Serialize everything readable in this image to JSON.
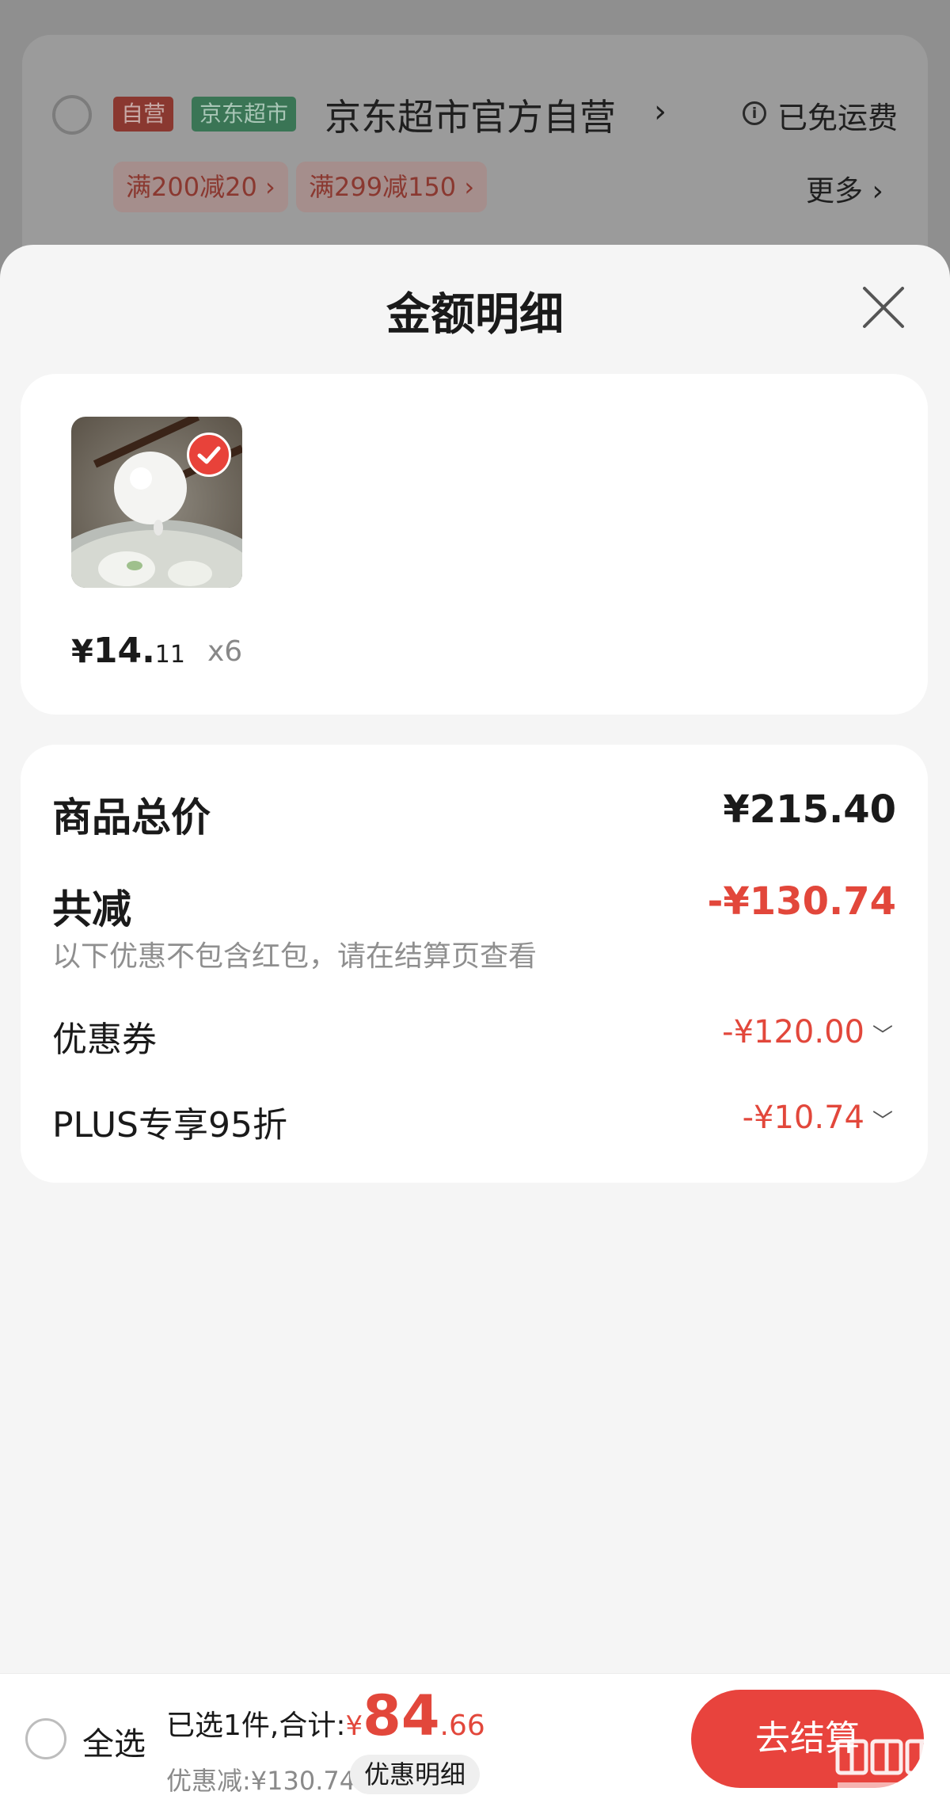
{
  "background_cart": {
    "tag_self": "自营",
    "tag_market": "京东超市",
    "shop_name": "京东超市官方自营",
    "shipping": "已免运费",
    "promos": [
      "满200减20 ›",
      "满299减150 ›"
    ],
    "more": "更多 ›"
  },
  "sheet": {
    "title": "金额明细",
    "product": {
      "price_currency": "¥",
      "price_int": "14.",
      "price_dec": "11",
      "quantity": "x6"
    },
    "summary": {
      "total_label": "商品总价",
      "total_value": "¥215.40",
      "reduce_label": "共减",
      "reduce_value": "-¥130.74",
      "note": "以下优惠不包含红包，请在结算页查看",
      "coupon_label": "优惠券",
      "coupon_value": "-¥120.00",
      "plus_label": "PLUS专享95折",
      "plus_value": "-¥10.74"
    }
  },
  "bottom_bar": {
    "select_all": "全选",
    "selected_text": "已选1件,合计:",
    "total_currency": "¥",
    "total_int": "84",
    "total_dec": ".66",
    "discount_text": "优惠减:¥130.74",
    "detail_button": "优惠明细",
    "checkout_button": "去结算"
  },
  "colors": {
    "accent_red": "#e2473b",
    "checkout_red": "#e8433d",
    "sheet_bg": "#f5f5f5"
  },
  "icons": [
    "close-icon",
    "check-icon",
    "chevron-down-icon",
    "info-icon",
    "chevron-right-icon"
  ]
}
